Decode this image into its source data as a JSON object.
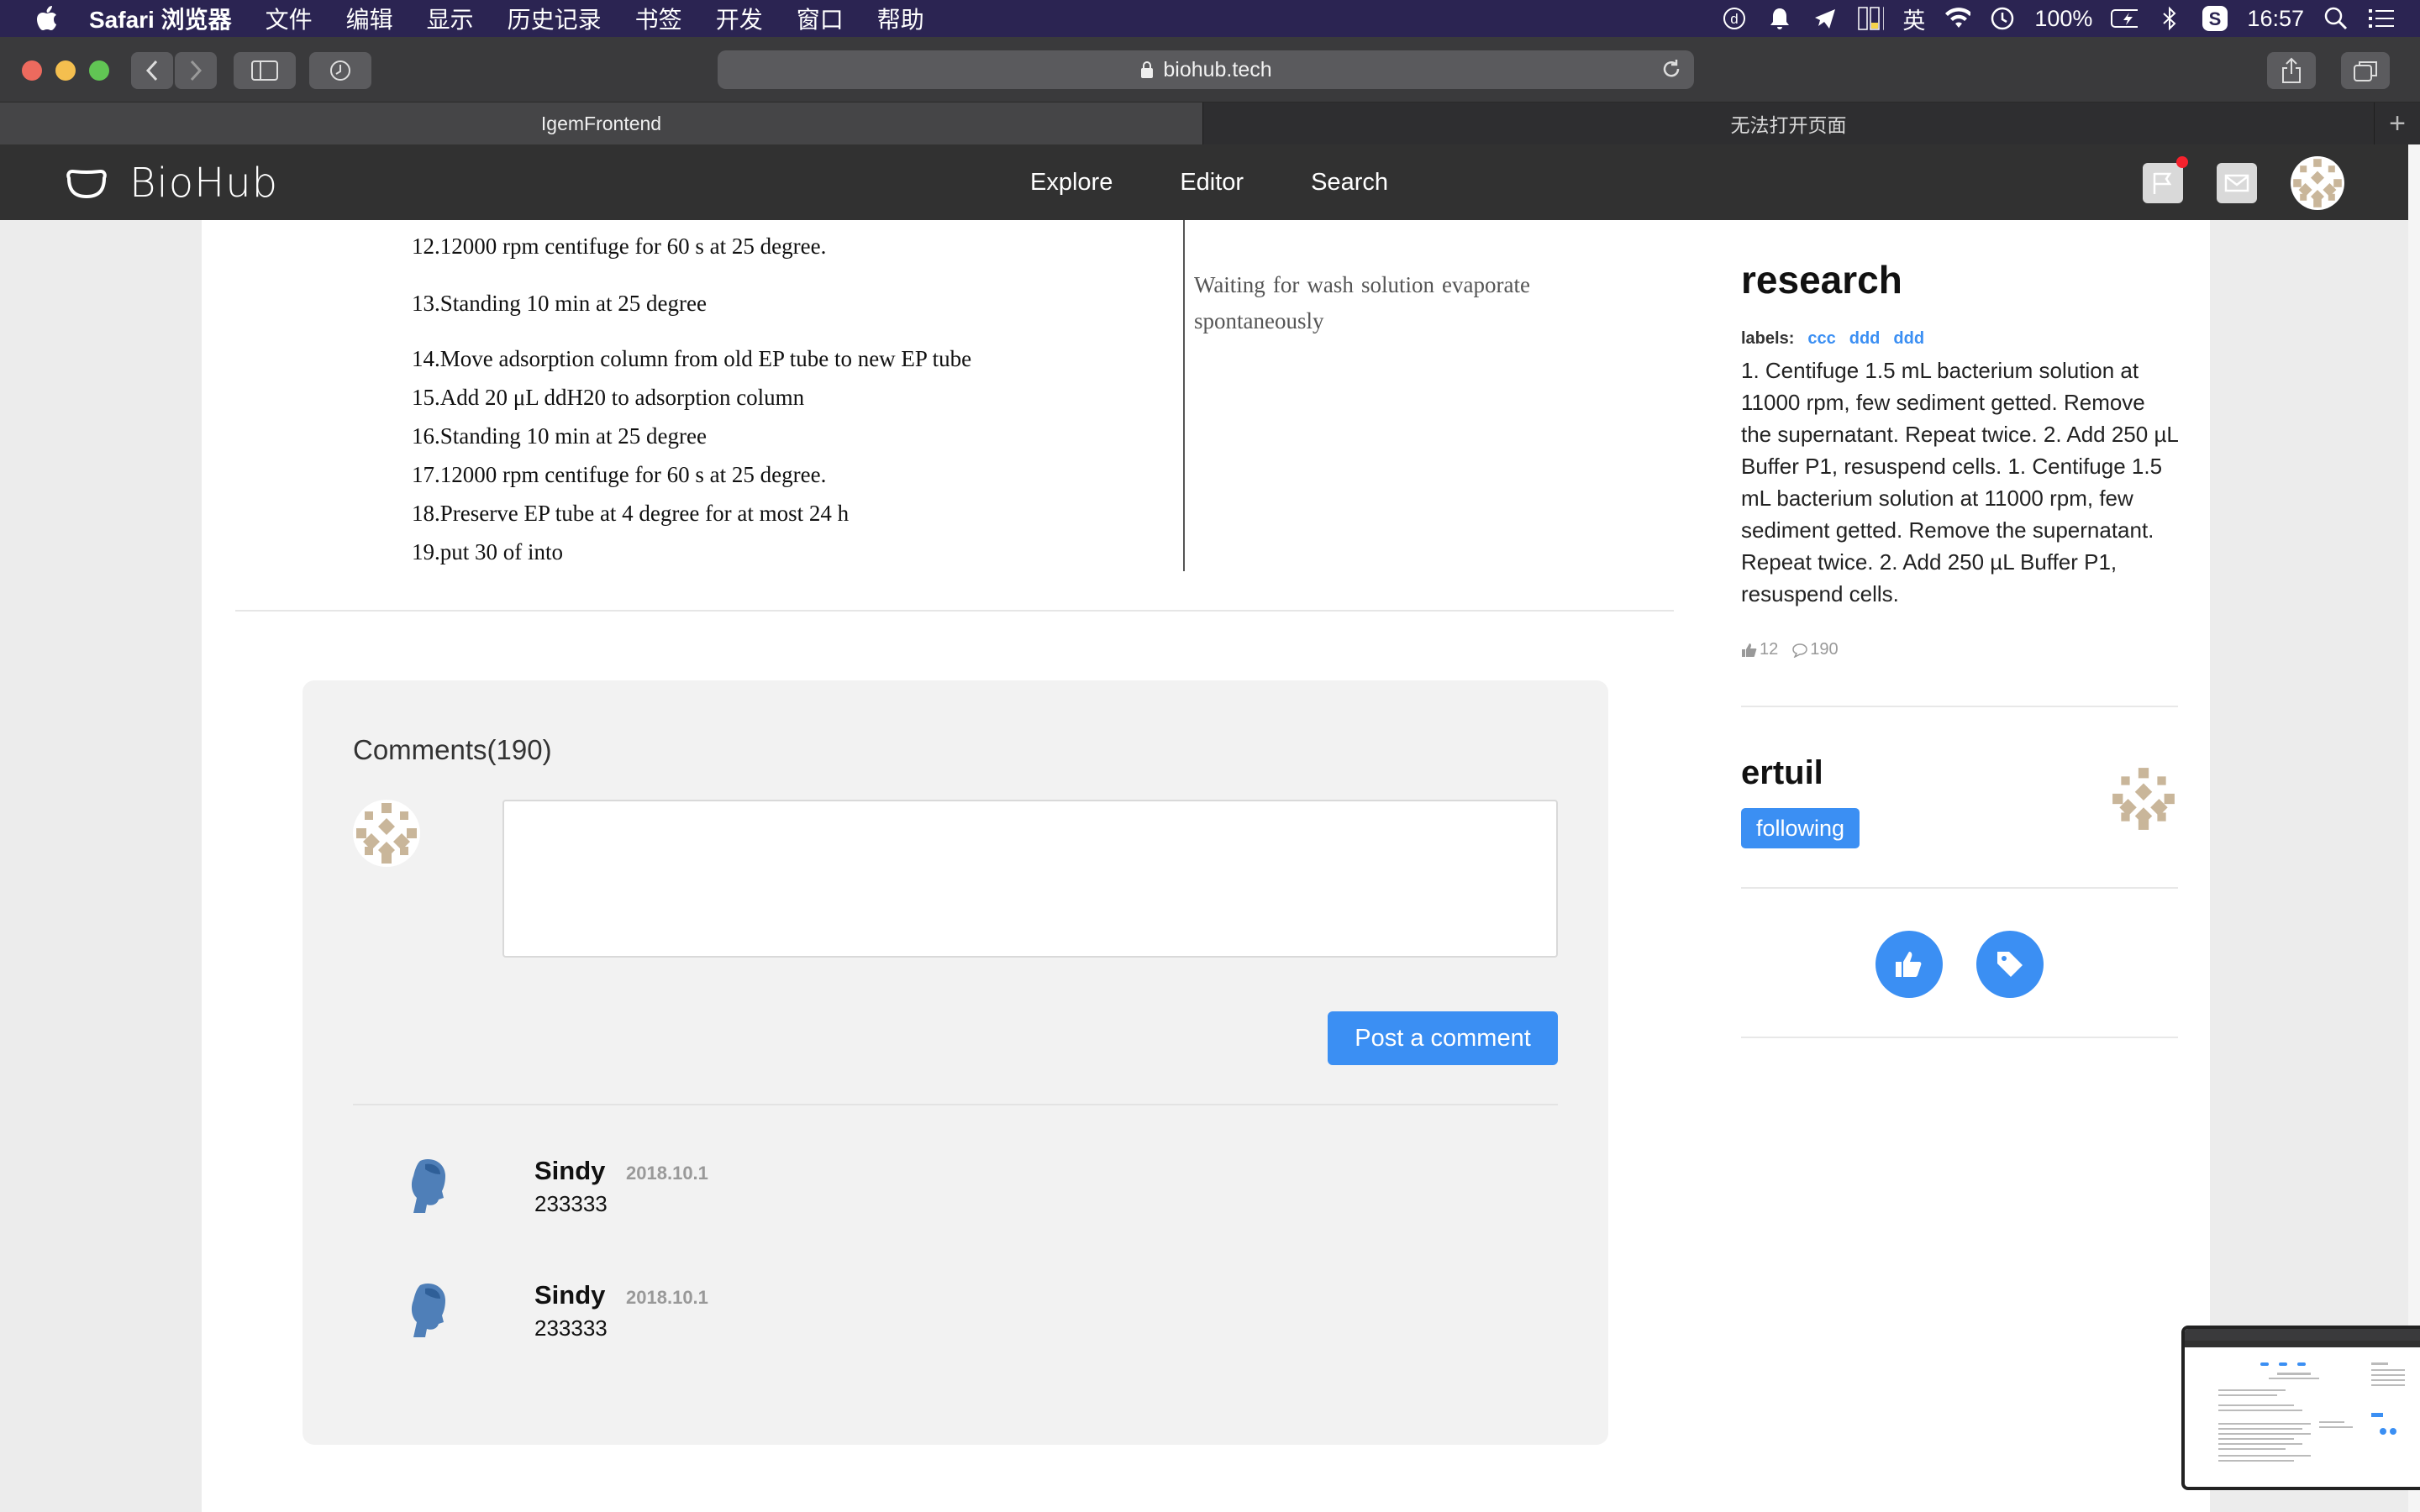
{
  "menubar": {
    "app": "Safari 浏览器",
    "items": [
      "文件",
      "编辑",
      "显示",
      "历史记录",
      "书签",
      "开发",
      "窗口",
      "帮助"
    ],
    "battery": "100%",
    "time": "16:57",
    "input_method": "英"
  },
  "browser": {
    "url": "biohub.tech",
    "tabs": [
      {
        "label": "IgemFrontend",
        "active": true
      },
      {
        "label": "无法打开页面",
        "active": false
      }
    ]
  },
  "site": {
    "logo": "BioHub",
    "nav": [
      "Explore",
      "Editor",
      "Search"
    ]
  },
  "protocol": {
    "steps": [
      "12.12000 rpm centifuge for 60 s at 25 degree.",
      "13.Standing 10 min at 25 degree",
      "14.Move adsorption column from old EP tube to new EP tube",
      "15.Add 20 μL ddH20 to adsorption column",
      "16.Standing 10 min at 25 degree",
      "17.12000 rpm centifuge for 60 s at 25 degree.",
      "18.Preserve EP tube at 4 degree for at most 24 h",
      "19.put 30 of into"
    ],
    "note": "Waiting for wash solution evaporate spontaneously"
  },
  "comments": {
    "title": "Comments(190)",
    "post_button": "Post a comment",
    "items": [
      {
        "name": "Sindy",
        "date": "2018.10.1",
        "text": "233333"
      },
      {
        "name": "Sindy",
        "date": "2018.10.1",
        "text": "233333"
      }
    ]
  },
  "sidebar": {
    "title": "research",
    "labels_heading": "labels:",
    "labels": [
      "ccc",
      "ddd",
      "ddd"
    ],
    "description": "1. Centifuge 1.5 mL bacterium solution at 11000 rpm, few sediment getted. Remove the supernatant. Repeat twice. 2. Add 250 µL Buffer P1, resuspend cells. 1. Centifuge 1.5 mL bacterium solution at 11000 rpm, few sediment getted. Remove the supernatant. Repeat twice. 2. Add 250 µL Buffer P1, resuspend cells.",
    "likes": "12",
    "comment_count": "190",
    "author": "ertuil",
    "follow_label": "following"
  },
  "colors": {
    "accent": "#3b8ff3",
    "menubar": "#2b2452",
    "nav": "#313131"
  }
}
